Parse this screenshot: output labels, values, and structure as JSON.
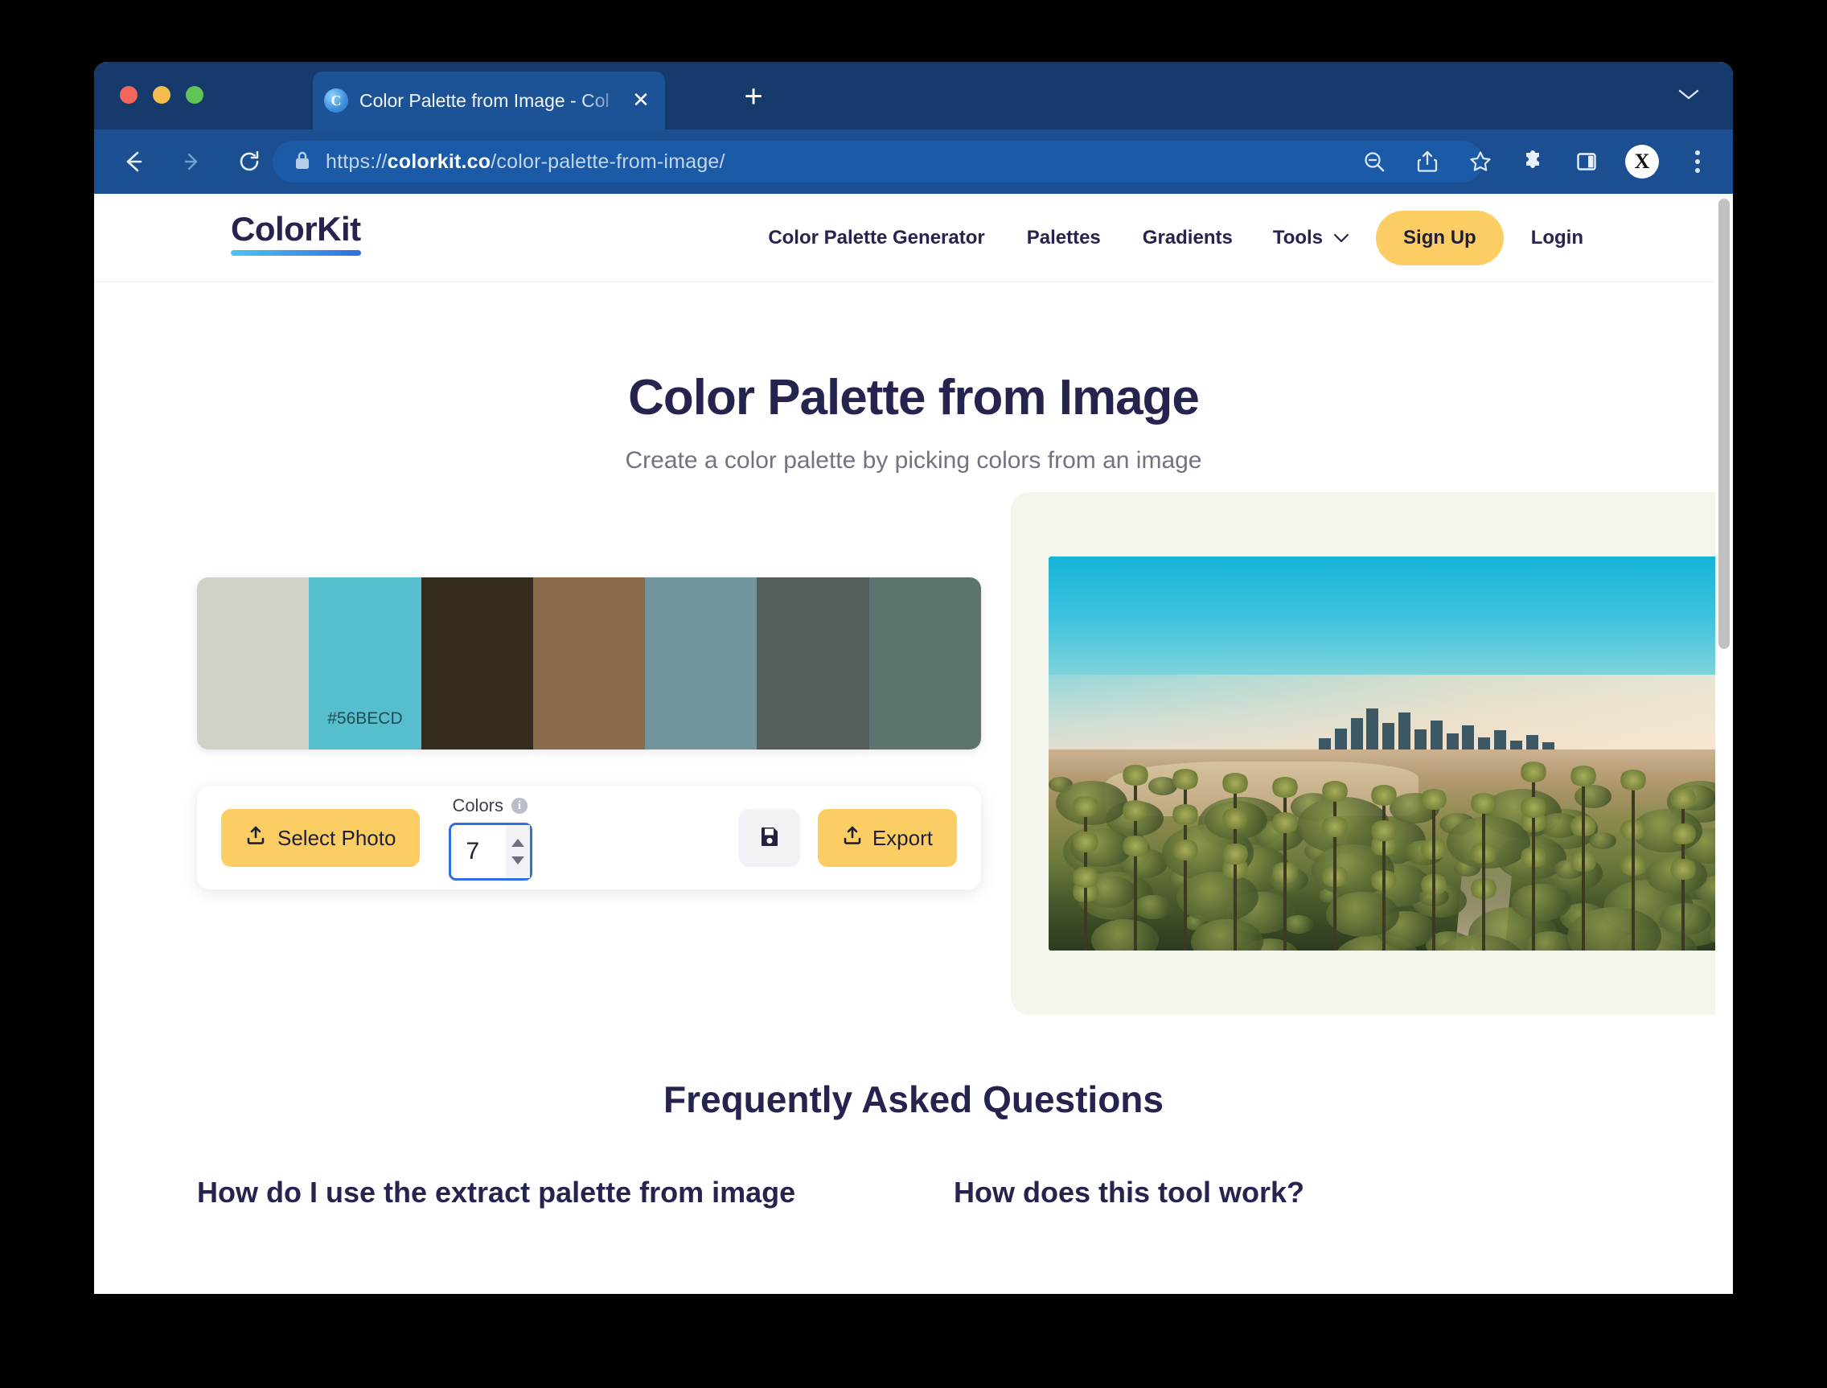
{
  "browser": {
    "tab": {
      "title": "Color Palette from Image - Col",
      "favicon_letter": "C",
      "close_label": "✕"
    },
    "new_tab_label": "+",
    "url_prefix": "https://",
    "url_domain": "colorkit.co",
    "url_path": "/color-palette-from-image/",
    "profile_initial": "X",
    "toolbar_icons": [
      "zoom-out-icon",
      "share-icon",
      "bookmark-star-icon",
      "extensions-puzzle-icon",
      "side-panel-icon",
      "profile-avatar",
      "browser-menu-icon"
    ],
    "nav_icons": [
      "back-icon",
      "forward-icon",
      "reload-icon"
    ]
  },
  "site": {
    "logo": "ColorKit",
    "nav": [
      {
        "label": "Color Palette Generator"
      },
      {
        "label": "Palettes"
      },
      {
        "label": "Gradients"
      },
      {
        "label": "Tools"
      }
    ],
    "signup_label": "Sign Up",
    "login_label": "Login"
  },
  "hero": {
    "title": "Color Palette from Image",
    "subtitle": "Create a color palette by picking colors from an image"
  },
  "palette": {
    "swatches": [
      {
        "hex": "#D0D2C9",
        "label": ""
      },
      {
        "hex": "#56BECD",
        "label": "#56BECD"
      },
      {
        "hex": "#332C1D",
        "label": ""
      },
      {
        "hex": "#8A6C4B",
        "label": ""
      },
      {
        "hex": "#71959D",
        "label": ""
      },
      {
        "hex": "#555E5A",
        "label": ""
      },
      {
        "hex": "#5C7370",
        "label": ""
      }
    ]
  },
  "controls": {
    "select_photo_label": "Select Photo",
    "colors_label": "Colors",
    "colors_value": "7",
    "info_icon_label": "i",
    "save_icon": "floppy-disk-icon",
    "export_label": "Export"
  },
  "preview": {
    "alt": "Aerial photo of the Los Angeles downtown skyline at golden hour with palm trees in the foreground"
  },
  "faq": {
    "title": "Frequently Asked Questions",
    "questions": [
      "How do I use the extract palette from image",
      "How does this tool work?"
    ]
  },
  "colors": {
    "accent": "#FBCD62",
    "brand_dark": "#24244E",
    "browser_chrome": "#1B4F92",
    "focus_blue": "#2F6FE0"
  }
}
